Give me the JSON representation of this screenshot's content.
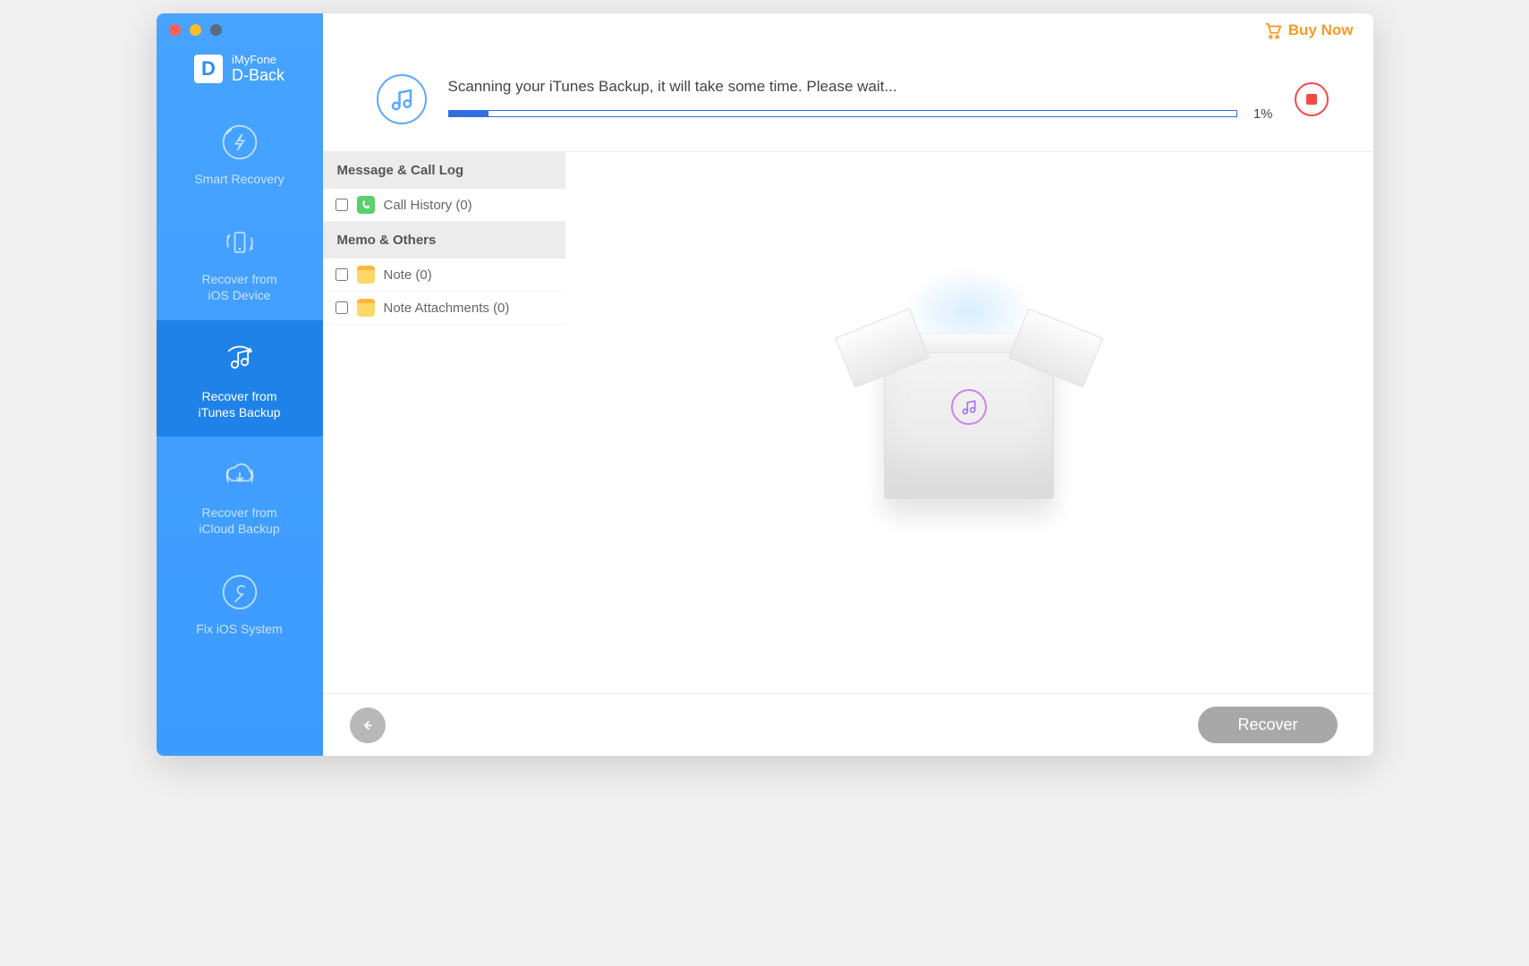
{
  "brand": {
    "logo_letter": "D",
    "line1": "iMyFone",
    "line2": "D-Back"
  },
  "topbar": {
    "buy_now": "Buy Now"
  },
  "sidebar": {
    "items": [
      {
        "label": "Smart Recovery"
      },
      {
        "label": "Recover from\niOS Device"
      },
      {
        "label": "Recover from\niTunes Backup"
      },
      {
        "label": "Recover from\niCloud Backup"
      },
      {
        "label": "Fix iOS System"
      }
    ],
    "active_index": 2
  },
  "progress": {
    "message": "Scanning your iTunes Backup, it will take some time. Please wait...",
    "percent_value": 1,
    "percent_label": "1%",
    "fill_width_percent": 5
  },
  "categories": {
    "group1": {
      "title": "Message & Call Log",
      "items": [
        {
          "label": "Call History (0)",
          "icon": "call"
        }
      ]
    },
    "group2": {
      "title": "Memo & Others",
      "items": [
        {
          "label": "Note (0)",
          "icon": "note"
        },
        {
          "label": "Note Attachments (0)",
          "icon": "noteatt"
        }
      ]
    }
  },
  "footer": {
    "recover_label": "Recover"
  }
}
